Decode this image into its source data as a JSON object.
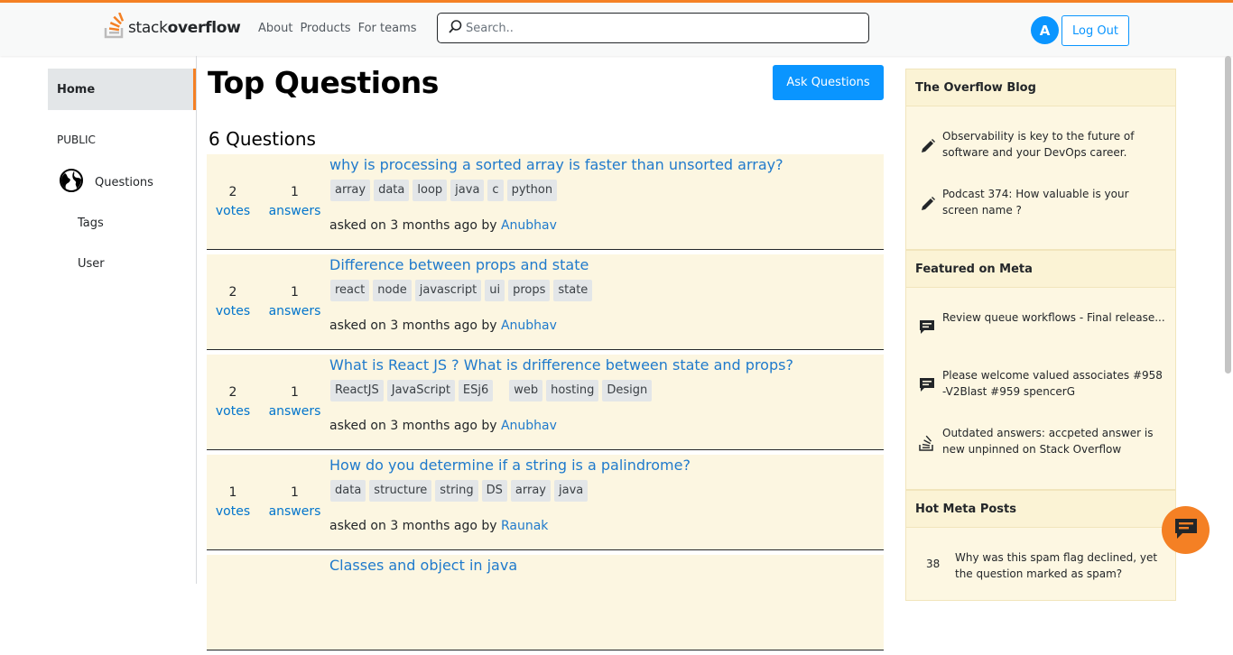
{
  "header": {
    "logo_text_light": "stack",
    "logo_text_bold": "overflow",
    "nav": [
      "About",
      "Products",
      "For teams"
    ],
    "search_placeholder": "Search..",
    "avatar_letter": "A",
    "logout_label": "Log Out"
  },
  "sidebar": {
    "home": "Home",
    "public": "PUBLIC",
    "questions": "Questions",
    "tags": "Tags",
    "user": "User"
  },
  "main": {
    "title": "Top Questions",
    "ask_button": "Ask Questions",
    "count_label": "6 Questions",
    "questions": [
      {
        "votes": "2",
        "votes_label": "votes",
        "answers": "1",
        "answers_label": "answers",
        "title": "why is processing a sorted array is faster than unsorted array?",
        "tags": [
          "array",
          "data",
          "loop",
          "java",
          "c",
          "python"
        ],
        "asked": "asked on 3 months ago by ",
        "author": "Anubhav"
      },
      {
        "votes": "2",
        "votes_label": "votes",
        "answers": "1",
        "answers_label": "answers",
        "title": "Difference between props and state",
        "tags": [
          "react",
          "node",
          "javascript",
          "ui",
          "props",
          "state"
        ],
        "asked": "asked on 3 months ago by ",
        "author": "Anubhav"
      },
      {
        "votes": "2",
        "votes_label": "votes",
        "answers": "1",
        "answers_label": "answers",
        "title": "What is React JS ? What is drifference between state and props?",
        "tags": [
          "ReactJS",
          "JavaScript",
          "ESj6",
          "",
          "web",
          "hosting",
          "Design"
        ],
        "asked": "asked on 3 months ago by ",
        "author": "Anubhav"
      },
      {
        "votes": "1",
        "votes_label": "votes",
        "answers": "1",
        "answers_label": "answers",
        "title": "How do you determine if a string is a palindrome?",
        "tags": [
          "data",
          "structure",
          "string",
          "DS",
          "array",
          "java"
        ],
        "asked": "asked on 3 months ago by ",
        "author": "Raunak"
      },
      {
        "votes": "",
        "votes_label": "",
        "answers": "",
        "answers_label": "",
        "title": "Classes and object in java",
        "tags": [],
        "asked": "",
        "author": ""
      }
    ]
  },
  "right": {
    "blog_title": "The Overflow Blog",
    "blog_items": [
      "Observability is key to the future of software and your DevOps career.",
      "Podcast 374: How valuable is your screen name ?"
    ],
    "meta_title": "Featured on Meta",
    "meta_items": [
      "Review queue workflows - Final release...",
      "Please welcome valued associates #958 -V2Blast #959 spencerG",
      "Outdated answers: accpeted answer is new unpinned on Stack Overflow"
    ],
    "hot_title": "Hot Meta Posts",
    "hot_items": [
      {
        "num": "38",
        "text": "Why was this spam flag declined, yet the question marked as spam?"
      }
    ]
  },
  "colors": {
    "accent": "#f48024",
    "primary": "#0a95ff",
    "link": "#1f7acc",
    "row_bg": "#fcf6e1",
    "panel_bg": "#fbf3d5"
  },
  "icons": {
    "logo": "stackoverflow-logo-icon",
    "search": "search-icon",
    "globe": "globe-icon",
    "pencil": "pencil-icon",
    "chat": "chat-bubble-icon",
    "stack": "stackoverflow-icon"
  }
}
